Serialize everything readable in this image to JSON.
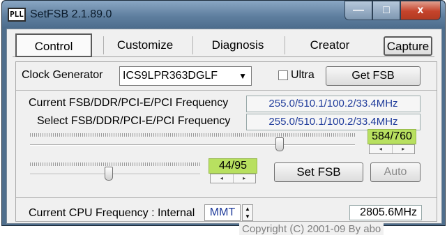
{
  "window": {
    "title": "SetFSB 2.1.89.0",
    "icon_text": "PLL",
    "min_glyph": "—",
    "max_glyph": "□",
    "close_glyph": "x"
  },
  "tabs": [
    {
      "label": "Control",
      "selected": true
    },
    {
      "label": "Customize"
    },
    {
      "label": "Diagnosis"
    },
    {
      "label": "Creator"
    }
  ],
  "capture_label": "Capture",
  "clock": {
    "label": "Clock Generator",
    "value": "ICS9LPR363DGLF",
    "arrow": "▼"
  },
  "ultra_label": "Ultra",
  "getfsb_label": "Get FSB",
  "current_freq": {
    "label": "Current FSB/DDR/PCI-E/PCI Frequency",
    "value": "255.0/510.1/100.2/33.4MHz"
  },
  "select_freq": {
    "label": "Select FSB/DDR/PCI-E/PCI Frequency",
    "value": "255.0/510.1/100.2/33.4MHz"
  },
  "slider1": {
    "value": "584/760",
    "fraction": 0.768
  },
  "slider2": {
    "value": "44/95",
    "fraction": 0.463
  },
  "spin": {
    "left": "◂",
    "right": "▸",
    "up": "▲",
    "down": "▼"
  },
  "setfsb_label": "Set FSB",
  "auto_label": "Auto",
  "cpu": {
    "label": "Current CPU Frequency : Internal",
    "source": "MMT",
    "value": "2805.6MHz"
  },
  "copyright": "Copyright (C) 2001-09 By abo"
}
